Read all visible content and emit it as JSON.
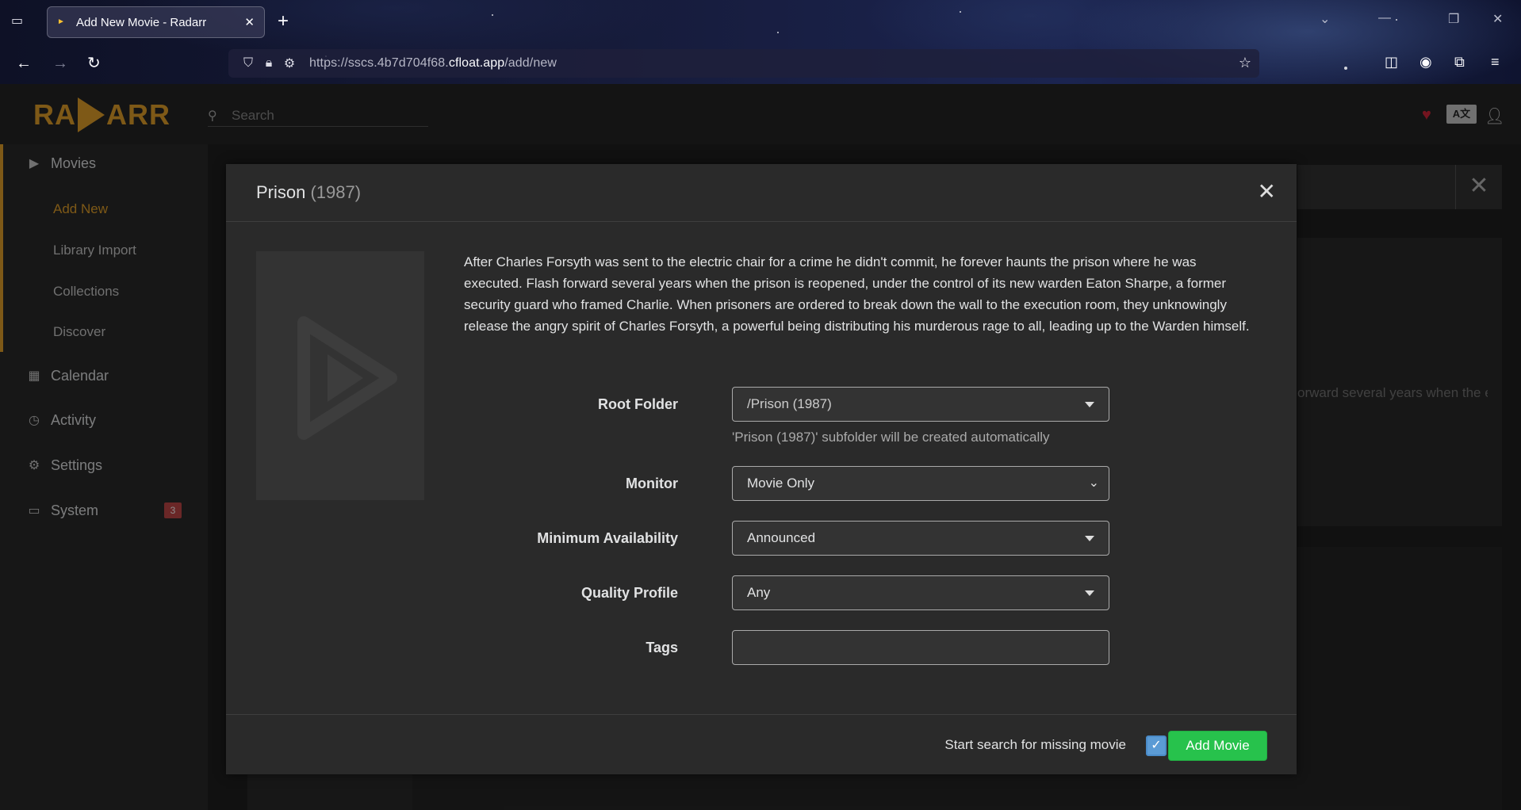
{
  "browser": {
    "tab_title": "Add New Movie - Radarr",
    "url_prefix": "https://sscs.4b7d704f68.",
    "url_host": "cfloat.app",
    "url_path": "/add/new"
  },
  "app": {
    "logo_left": "RA",
    "logo_right": "ARR",
    "search_placeholder": "Search",
    "lang_badge": "A文"
  },
  "sidebar": {
    "movies": "Movies",
    "sub_items": [
      "Add New",
      "Library Import",
      "Collections",
      "Discover"
    ],
    "calendar": "Calendar",
    "activity": "Activity",
    "settings": "Settings",
    "system": "System",
    "system_badge": "3"
  },
  "background": {
    "overview_fragment": "orward several years when the ed to break down the wall to ing up to the Warden himself."
  },
  "modal": {
    "title": "Prison",
    "year": "(1987)",
    "overview": "After Charles Forsyth was sent to the electric chair for a crime he didn't commit, he forever haunts the prison where he was executed. Flash forward several years when the prison is reopened, under the control of its new warden Eaton Sharpe, a former security guard who framed Charlie. When prisoners are ordered to break down the wall to the execution room, they unknowingly release the angry spirit of Charles Forsyth, a powerful being distributing his murderous rage to all, leading up to the Warden himself.",
    "form": {
      "root_folder_label": "Root Folder",
      "root_folder_value": "/Prison (1987)",
      "root_folder_help": "'Prison (1987)' subfolder will be created automatically",
      "monitor_label": "Monitor",
      "monitor_value": "Movie Only",
      "min_availability_label": "Minimum Availability",
      "min_availability_value": "Announced",
      "quality_profile_label": "Quality Profile",
      "quality_profile_value": "Any",
      "tags_label": "Tags",
      "tags_value": ""
    },
    "footer": {
      "search_label": "Start search for missing movie",
      "search_checked": true,
      "add_button": "Add Movie"
    }
  },
  "colors": {
    "accent": "#e6a22a",
    "success": "#27c24c",
    "checkbox": "#5b9bd5",
    "badge": "#c14747"
  }
}
